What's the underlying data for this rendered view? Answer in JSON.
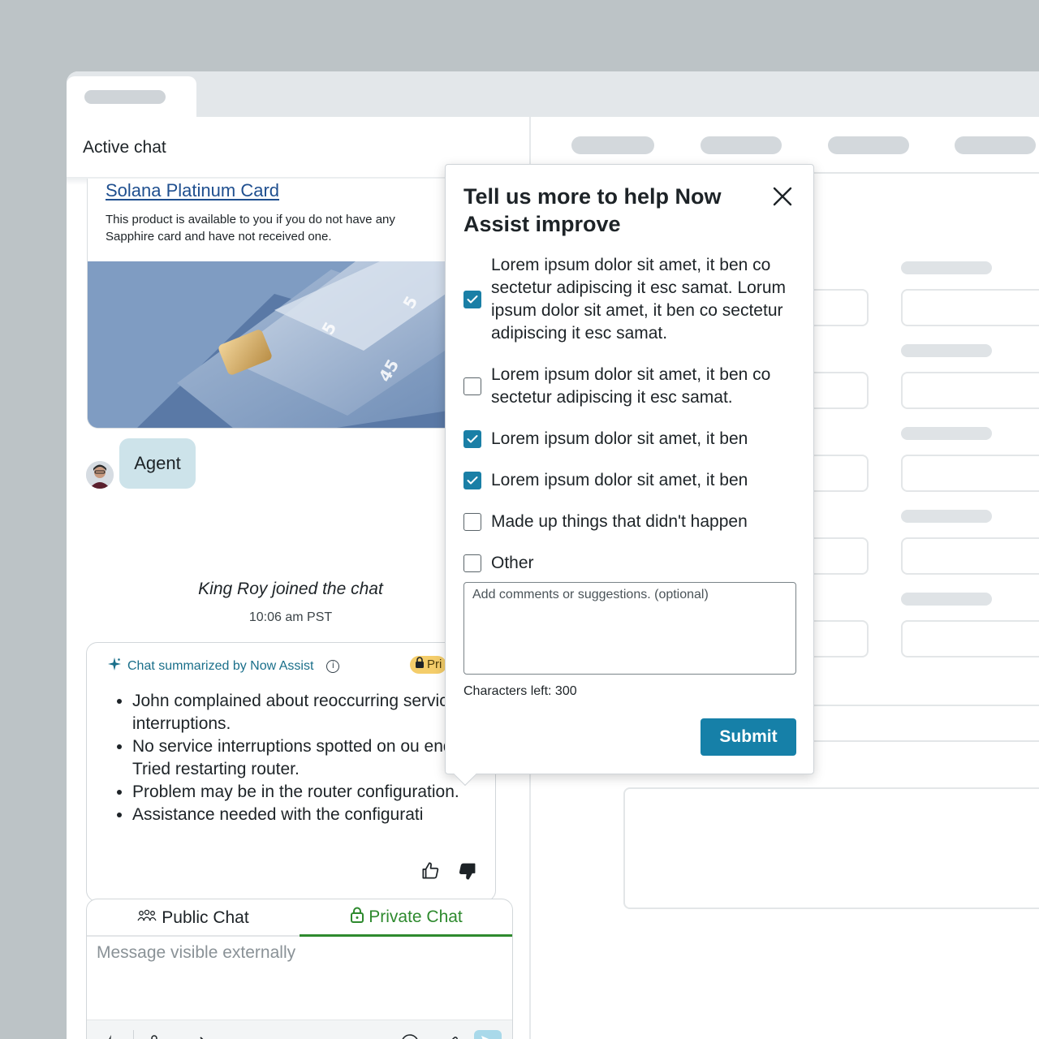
{
  "panel": {
    "title": "Active chat"
  },
  "product_card": {
    "title": "Solana Platinum Card",
    "description": "This product is available to you if you do not have any Sapphire card and have not received one."
  },
  "agent": {
    "label": "Agent"
  },
  "system_message": {
    "text": "King Roy joined the chat",
    "time": "10:06 am PST"
  },
  "summary": {
    "header": "Chat summarized by Now Assist",
    "badge": "Pri",
    "bullets": [
      "John complained about reoccurring service interruptions.",
      "No service interruptions spotted on ou end. Tried restarting router.",
      "Problem may be in the router configuration.",
      "Assistance needed with the configurati"
    ]
  },
  "composer": {
    "tab_public": "Public Chat",
    "tab_private": "Private Chat",
    "placeholder": "Message visible externally"
  },
  "feedback": {
    "title": "Tell us more to help Now Assist improve",
    "options": [
      {
        "label": "Lorem ipsum dolor sit amet, it ben co sectetur adipiscing it esc samat. Lorum ipsum dolor sit amet, it ben co sectetur adipiscing it esc samat.",
        "checked": true
      },
      {
        "label": "Lorem ipsum dolor sit amet, it ben co sectetur adipiscing it esc samat.",
        "checked": false
      },
      {
        "label": "Lorem ipsum dolor sit amet, it ben",
        "checked": true
      },
      {
        "label": "Lorem ipsum dolor sit amet, it ben",
        "checked": true
      },
      {
        "label": "Made up things that didn't happen",
        "checked": false
      },
      {
        "label": "Other",
        "checked": false
      }
    ],
    "comment_placeholder": "Add comments or suggestions. (optional)",
    "chars_left": "Characters left: 300",
    "submit_label": "Submit"
  },
  "colors": {
    "accent": "#1680a8",
    "private_green": "#2e8a2e",
    "agent_bubble": "#cde3ea",
    "badge_yellow": "#f4cd6a"
  },
  "icons": {
    "sparkle": "sparkle-icon",
    "info": "info-icon",
    "lock": "lock-icon",
    "thumbs_up": "thumbs-up-icon",
    "thumbs_down": "thumbs-down-icon",
    "close": "close-icon",
    "group": "group-icon",
    "bolt": "bolt-icon",
    "transfer": "transfer-icon",
    "arrow": "arrow-right-icon",
    "emoji": "emoji-icon",
    "attach": "paperclip-icon",
    "send": "send-icon"
  }
}
